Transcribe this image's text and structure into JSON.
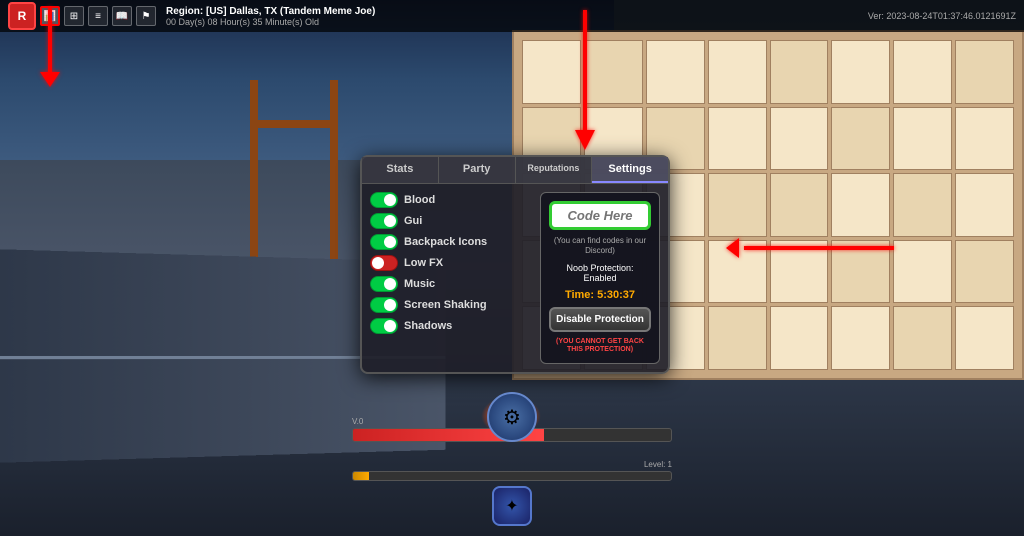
{
  "hud": {
    "region_label": "Region: [US] Dallas, TX (Tandem Meme Joe)",
    "time_online": "00 Day(s) 08 Hour(s) 35 Minute(s) Old",
    "version": "Ver: 2023-08-24T01:37:46.0121691Z"
  },
  "tabs": {
    "stats": "Stats",
    "party": "Party",
    "reputations": "Reputations",
    "settings": "Settings",
    "active": "settings"
  },
  "toggles": [
    {
      "label": "Blood",
      "enabled": true
    },
    {
      "label": "Gui",
      "enabled": true
    },
    {
      "label": "Backpack Icons",
      "enabled": true
    },
    {
      "label": "Low FX",
      "enabled": false
    },
    {
      "label": "Music",
      "enabled": true
    },
    {
      "label": "Screen Shaking",
      "enabled": true
    },
    {
      "label": "Shadows",
      "enabled": true
    }
  ],
  "settings_panel": {
    "code_placeholder": "Code Here",
    "code_hint": "(You can find codes in our Discord)",
    "protection_label": "Noob Protection: Enabled",
    "protection_time_label": "Time: 5:30:37",
    "disable_button": "Disable Protection",
    "warning_text": "(YOU CANNOT GET BACK THIS PROTECTION)"
  },
  "player": {
    "hp_current": "V.0",
    "hp_label": "",
    "level_label": "Level: 1"
  },
  "icons": {
    "roblox": "▣",
    "menu": "☰",
    "star": "★",
    "book": "📖",
    "flag": "⚑",
    "character": "⚙",
    "skill": "✦"
  }
}
